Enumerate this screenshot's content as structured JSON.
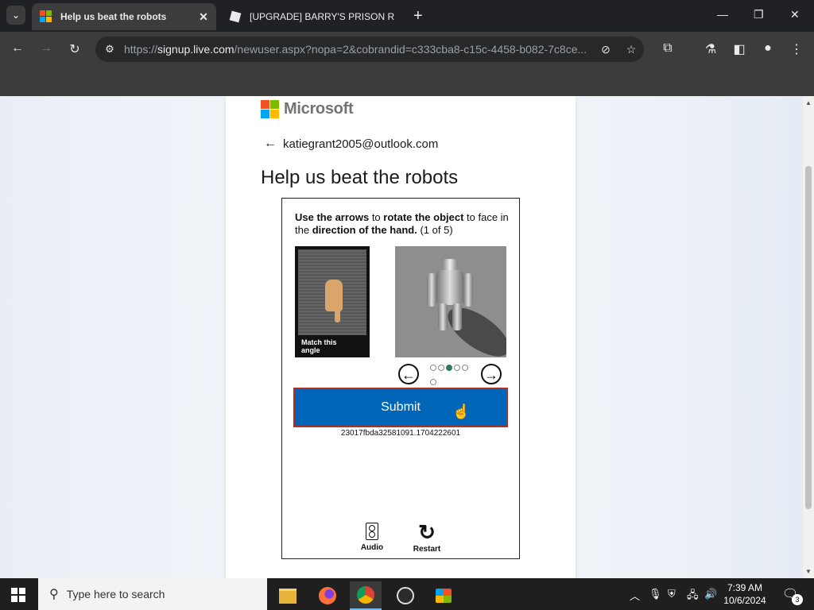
{
  "browser": {
    "tabs": [
      {
        "title": "Help us beat the robots",
        "active": true,
        "favicon": "microsoft-logo-icon"
      },
      {
        "title": "[UPGRADE] BARRY'S PRISON R",
        "active": false,
        "favicon": "roblox-logo-icon"
      }
    ],
    "url": {
      "scheme": "https://",
      "host": "signup.live.com",
      "path": "/newuser.aspx?nopa=2&cobrandid=c333cba8-c15c-4458-b082-7c8ce..."
    }
  },
  "page": {
    "brand": "Microsoft",
    "email": "katiegrant2005@outlook.com",
    "heading": "Help us beat the robots",
    "captcha": {
      "instr": {
        "p1": "Use the arrows",
        "p2": " to ",
        "p3": "rotate the object",
        "p4": " to face in the ",
        "p5": "direction of the hand.",
        "p6": " (1 of 5)"
      },
      "hand_label": "Match this angle",
      "progress": {
        "current": 3,
        "total": 6
      },
      "submit_label": "Submit",
      "session_id": "23017fbda32581091.1704222601",
      "audio_label": "Audio",
      "restart_label": "Restart"
    }
  },
  "taskbar": {
    "search_placeholder": "Type here to search",
    "time": "7:39 AM",
    "date": "10/6/2024",
    "notification_count": "3"
  },
  "colors": {
    "submit_bg": "#0067b8",
    "submit_border": "#b5301a",
    "active_dot": "#2e7d5a"
  }
}
